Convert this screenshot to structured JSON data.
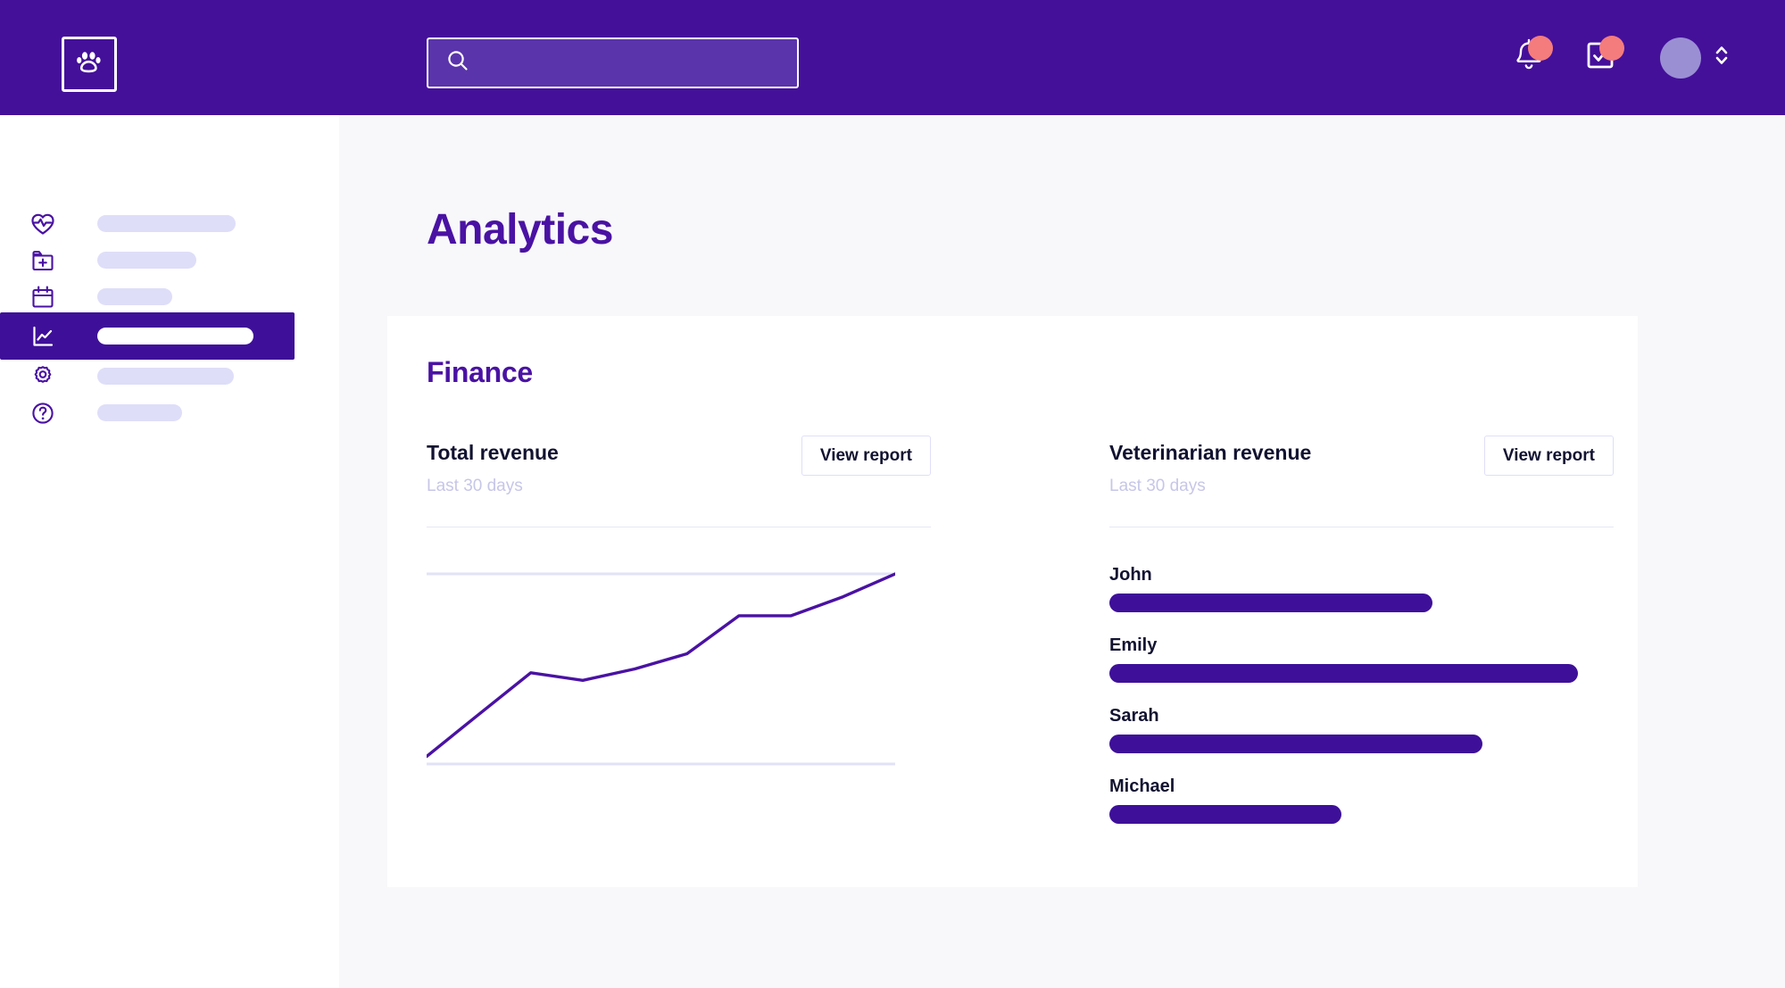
{
  "brand": {
    "logo_icon": "paw-icon",
    "primary_color": "#44109A",
    "accent_color": "#3E1099",
    "badge_color": "#F47C7C"
  },
  "header": {
    "search": {
      "icon": "search-icon",
      "value": "",
      "placeholder": ""
    },
    "notifications_icon": "bell-icon",
    "tasks_icon": "checkbox-check-icon",
    "avatar_icon": "avatar",
    "account_caret_icon": "chevron-up-down-icon",
    "notification_badge": "",
    "tasks_badge": ""
  },
  "sidebar": {
    "items": [
      {
        "icon": "heart-pulse-icon",
        "label": "",
        "pill_width": 155,
        "active": false
      },
      {
        "icon": "folder-plus-icon",
        "label": "",
        "pill_width": 111,
        "active": false
      },
      {
        "icon": "calendar-icon",
        "label": "",
        "pill_width": 84,
        "active": false
      },
      {
        "icon": "chart-line-icon",
        "label": "",
        "pill_width": 175,
        "active": true
      },
      {
        "icon": "gear-icon",
        "label": "",
        "pill_width": 153,
        "active": false
      },
      {
        "icon": "help-circle-icon",
        "label": "",
        "pill_width": 95,
        "active": false
      }
    ]
  },
  "main": {
    "page_title": "Analytics",
    "card": {
      "title": "Finance",
      "panels": [
        {
          "heading": "Total revenue",
          "subtitle": "Last 30 days",
          "button_label": "View report"
        },
        {
          "heading": "Veterinarian revenue",
          "subtitle": "Last 30 days",
          "button_label": "View report"
        }
      ]
    }
  },
  "chart_data": [
    {
      "type": "line",
      "title": "Total revenue",
      "subtitle": "Last 30 days",
      "xlabel": "",
      "ylabel": "",
      "grid": true,
      "gridlines": [
        0,
        100
      ],
      "legend": "none",
      "line_color": "#4a12a3",
      "x": [
        0,
        1,
        2,
        3,
        4,
        5,
        6,
        7,
        8,
        9
      ],
      "values": [
        4,
        26,
        48,
        44,
        50,
        58,
        78,
        78,
        88,
        100
      ],
      "ylim": [
        0,
        100
      ],
      "xlim": [
        0,
        9
      ]
    },
    {
      "type": "bar",
      "orientation": "horizontal",
      "title": "Veterinarian revenue",
      "subtitle": "Last 30 days",
      "xlabel": "",
      "ylabel": "",
      "grid": false,
      "legend": "none",
      "bar_color": "#3E1099",
      "categories": [
        "John",
        "Emily",
        "Sarah",
        "Michael"
      ],
      "values": [
        64,
        93,
        74,
        46
      ],
      "xlim": [
        0,
        100
      ]
    }
  ]
}
